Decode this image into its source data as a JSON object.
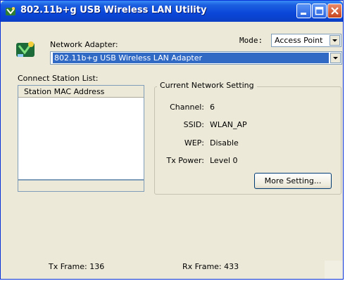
{
  "window": {
    "title": "802.11b+g USB Wireless LAN Utility",
    "icon": "wireless-utility-icon"
  },
  "adapter": {
    "label": "Network Adapter:",
    "selected": "802.11b+g USB Wireless LAN Adapter"
  },
  "mode": {
    "label": "Mode:",
    "selected": "Access Point"
  },
  "station_list": {
    "label": "Connect Station List:",
    "column_header": "Station MAC Address",
    "rows": []
  },
  "network_setting": {
    "title": "Current Network Setting",
    "channel_label": "Channel:",
    "channel_value": "6",
    "ssid_label": "SSID:",
    "ssid_value": "WLAN_AP",
    "wep_label": "WEP:",
    "wep_value": "Disable",
    "txpower_label": "Tx Power:",
    "txpower_value": "Level 0",
    "more_button": "More Setting..."
  },
  "status": {
    "tx_frame": "Tx Frame:  136",
    "rx_frame": "Rx Frame:  433"
  },
  "colors": {
    "titlebar": "#0a46d8",
    "selection": "#316ac5",
    "window_bg": "#ece9d8"
  }
}
